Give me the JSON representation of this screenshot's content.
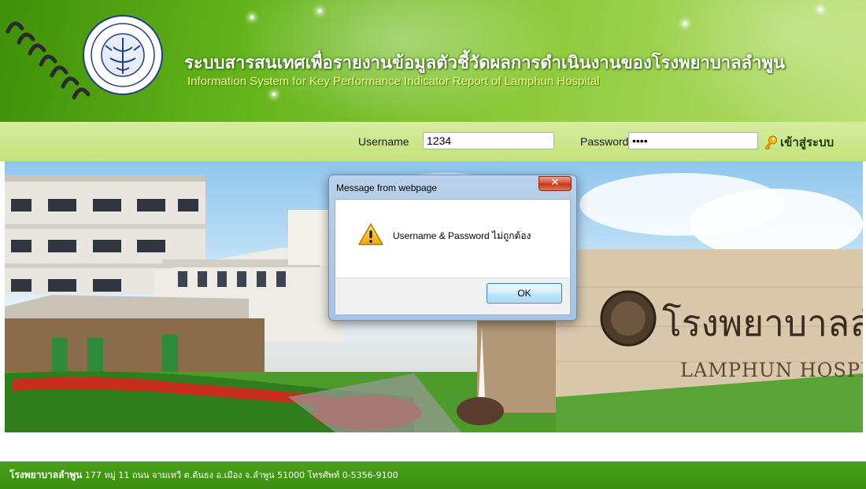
{
  "header": {
    "title_th": "ระบบสารสนเทศเพื่อรายงานข้อมูลตัวชี้วัดผลการดำเนินงานของโรงพยาบาลลำพูน",
    "title_en": "Information System for Key Performance Indicator Report of Lamphun Hospital",
    "seal_icon": "hospital-seal-icon"
  },
  "login": {
    "username_label": "Username",
    "username_value": "1234",
    "password_label": "Password",
    "password_value": "••••",
    "login_label": "เข้าสู่ระบบ",
    "login_icon": "key-icon"
  },
  "banner": {
    "sign_th": "โรงพยาบาลลำพูน",
    "sign_en": "LAMPHUN HOSPITAL"
  },
  "dialog": {
    "caption": "Message from webpage",
    "close_glyph": "✕",
    "message": "Username & Password ไม่ถูกต้อง",
    "ok_label": "OK",
    "icon": "warning-icon"
  },
  "footer": {
    "name": "โรงพยาบาลลำพูน",
    "address": " 177 หมู่ 11 ถนน จามเทวี ต.ต้นธง อ.เมือง จ.ลำพูน 51000 โทรศัพท์ 0-5356-9100"
  },
  "colors": {
    "header_green": "#66b51d",
    "login_bar": "#c3e37b",
    "footer_green": "#3b8f10",
    "dialog_frame": "#a7c3e2"
  }
}
